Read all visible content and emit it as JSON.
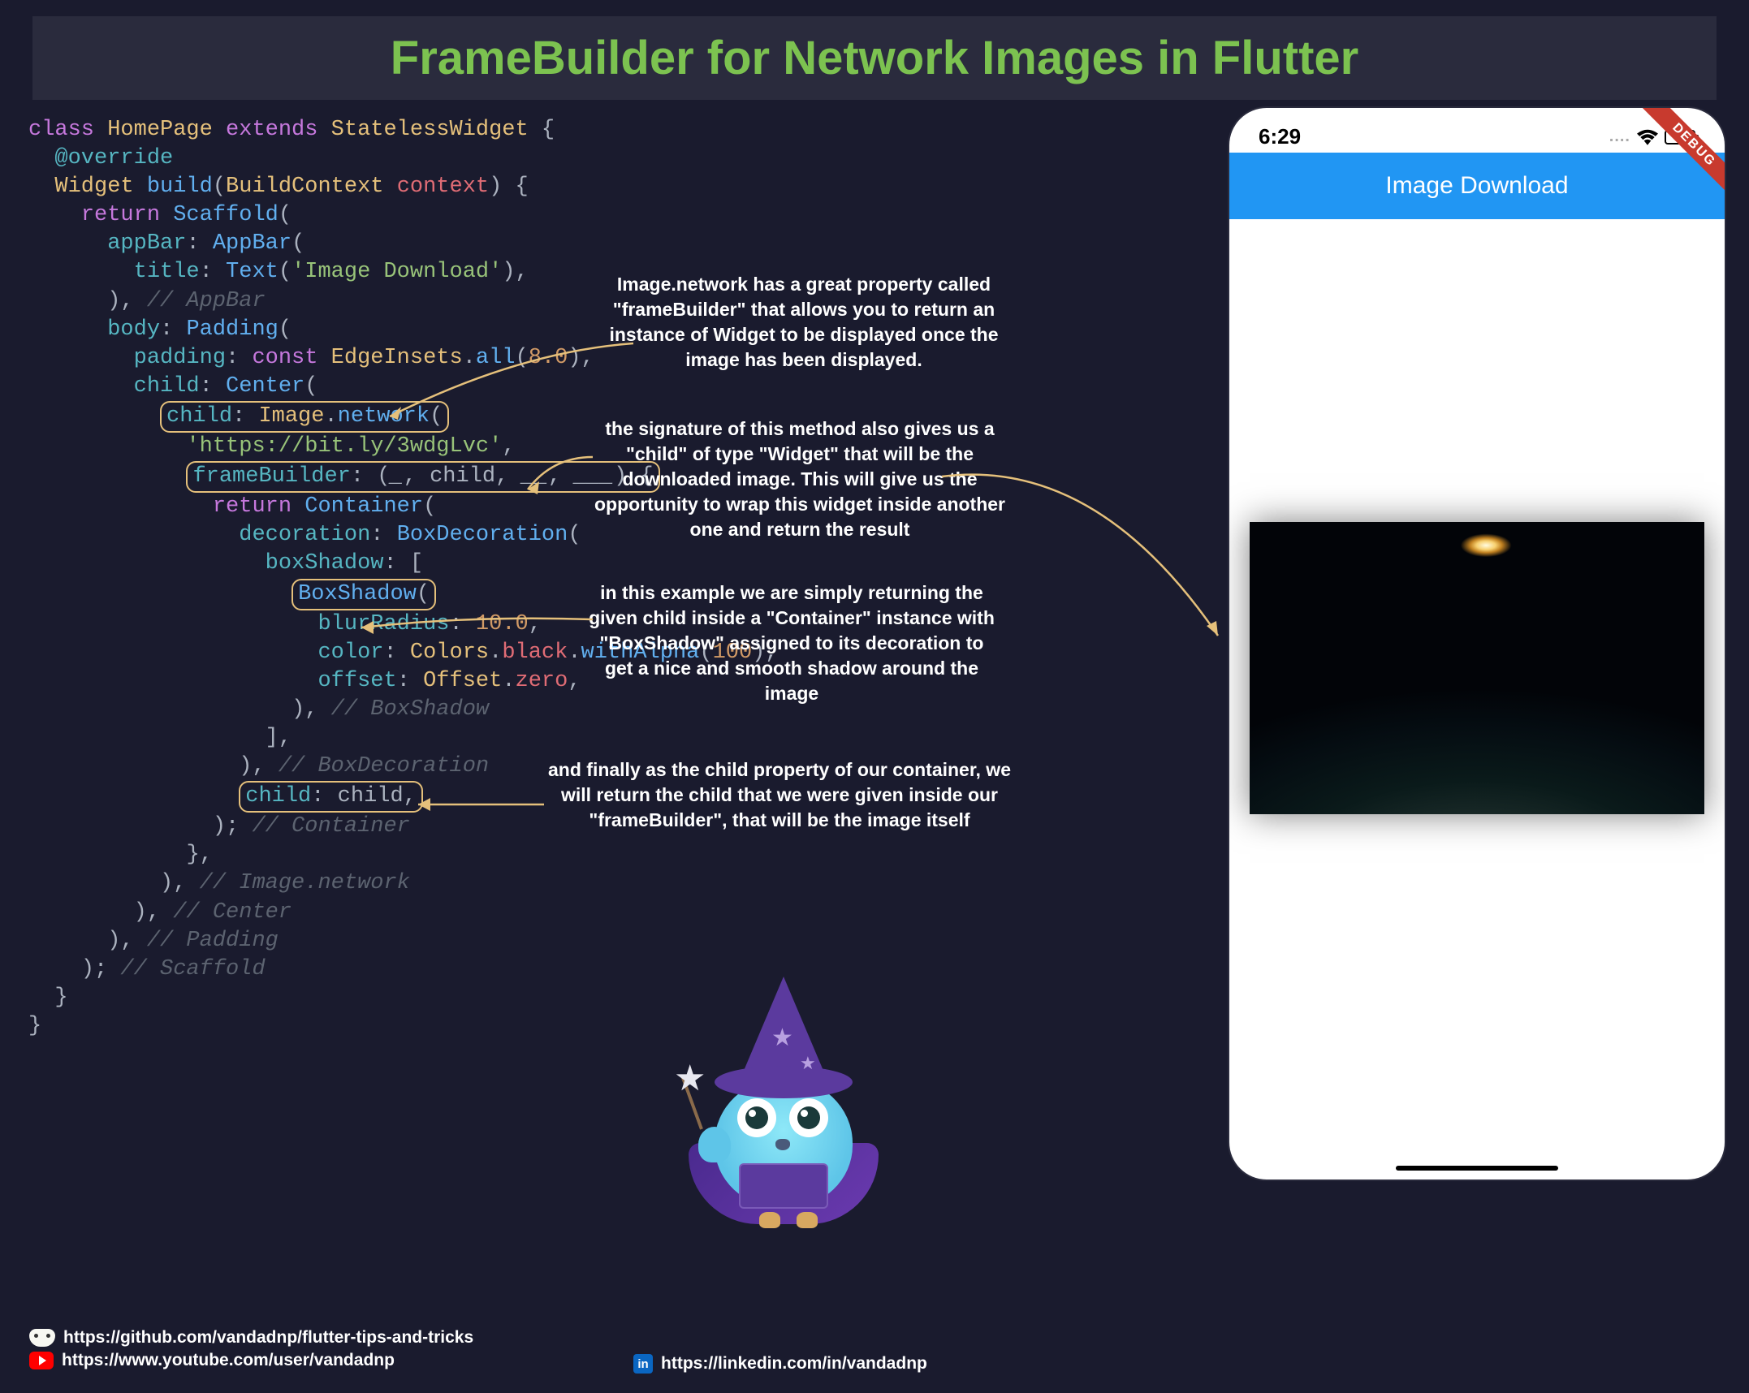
{
  "title": "FrameBuilder for Network Images in Flutter",
  "annotations": {
    "a1": "Image.network has a great property called \"frameBuilder\" that allows you to return an instance of Widget to be displayed once the image has been displayed.",
    "a2": "the signature of this method also gives us a \"child\" of type \"Widget\" that will be the downloaded image. This will give us the opportunity to wrap this widget inside another one and return the result",
    "a3": "in this example we are simply returning the given child inside a \"Container\" instance with \"BoxShadow\" assigned to its decoration to get a nice and smooth shadow around the image",
    "a4": "and finally as the child property of our container, we will return the child that we were given inside our \"frameBuilder\", that will be the image itself"
  },
  "phone": {
    "time": "6:29",
    "appbar_title": "Image Download",
    "debug_label": "DEBUG"
  },
  "code": {
    "l1_class": "class ",
    "l1_name": "HomePage ",
    "l1_extends": "extends ",
    "l1_super": "StatelessWidget ",
    "l1_brace": "{",
    "l2_override": "@override",
    "l3_widget": "Widget ",
    "l3_build": "build",
    "l3_open": "(",
    "l3_ctx": "BuildContext ",
    "l3_param": "context",
    "l3_close": ") {",
    "l4_return": "return ",
    "l4_scaffold": "Scaffold",
    "l4_p": "(",
    "l5_appbar": "appBar",
    "l5_colon": ": ",
    "l5_AppBar": "AppBar",
    "l5_p": "(",
    "l6_title": "title",
    "l6_colon": ": ",
    "l6_Text": "Text",
    "l6_p": "(",
    "l6_str": "'Image Download'",
    "l6_close": "),",
    "l7_close": "), ",
    "l7_comment": "// AppBar",
    "l8_body": "body",
    "l8_colon": ": ",
    "l8_Padding": "Padding",
    "l8_p": "(",
    "l9_padding": "padding",
    "l9_colon": ": ",
    "l9_const": "const ",
    "l9_Edge": "EdgeInsets",
    "l9_dot": ".",
    "l9_all": "all",
    "l9_p": "(",
    "l9_num": "8.0",
    "l9_close": "),",
    "l10_child": "child",
    "l10_colon": ": ",
    "l10_Center": "Center",
    "l10_p": "(",
    "hl1_child": "child",
    "hl1_colon": ": ",
    "hl1_Image": "Image",
    "hl1_dot": ".",
    "hl1_network": "network",
    "hl1_p": "(",
    "l12_url": "'https://bit.ly/3wdgLvc'",
    "l12_comma": ",",
    "hl2_fb": "frameBuilder",
    "hl2_colon": ": (",
    "hl2_u1": "_",
    "hl2_c1": ", child, ",
    "hl2_u2": "__",
    "hl2_c2": ", ",
    "hl2_u3": "___",
    "hl2_close": ") {",
    "l14_return": "return ",
    "l14_Container": "Container",
    "l14_p": "(",
    "l15_decoration": "decoration",
    "l15_colon": ": ",
    "l15_Box": "BoxDecoration",
    "l15_p": "(",
    "l16_boxShadow": "boxShadow",
    "l16_colon": ": [",
    "hl3_BoxShadow": "BoxShadow",
    "hl3_p": "(",
    "l18_blur": "blurRadius",
    "l18_colon": ": ",
    "l18_num": "10.0",
    "l18_comma": ",",
    "l19_color": "color",
    "l19_colon": ": ",
    "l19_Colors": "Colors",
    "l19_d1": ".",
    "l19_black": "black",
    "l19_d2": ".",
    "l19_withAlpha": "withAlpha",
    "l19_p": "(",
    "l19_num": "100",
    "l19_close": "),",
    "l20_offset": "offset",
    "l20_colon": ": ",
    "l20_Offset": "Offset",
    "l20_dot": ".",
    "l20_zero": "zero",
    "l20_comma": ",",
    "l21_close": "), ",
    "l21_comment": "// BoxShadow",
    "l22_close": "],",
    "l23_close": "), ",
    "l23_comment": "// BoxDecoration",
    "hl4_child": "child",
    "hl4_colon": ": child,",
    "l25_close": "); ",
    "l25_comment": "// Container",
    "l26_close": "},",
    "l27_close": "), ",
    "l27_comment": "// Image.network",
    "l28_close": "), ",
    "l28_comment": "// Center",
    "l29_close": "), ",
    "l29_comment": "// Padding",
    "l30_close": "); ",
    "l30_comment": "// Scaffold",
    "l31_close": "}",
    "l32_close": "}"
  },
  "links": {
    "github": "https://github.com/vandadnp/flutter-tips-and-tricks",
    "youtube": "https://www.youtube.com/user/vandadnp",
    "linkedin": "https://linkedin.com/in/vandadnp",
    "li_abbr": "in"
  }
}
